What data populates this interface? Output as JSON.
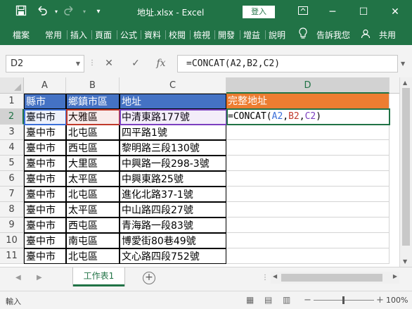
{
  "window": {
    "title": "地址.xlsx - Excel",
    "login_label": "登入",
    "minimize": "─",
    "restore": "☐",
    "close": "✕"
  },
  "quick_access": {
    "save_icon": "save-icon",
    "undo_icon": "undo-icon",
    "redo_icon": "redo-icon",
    "customize_icon": "customize-icon"
  },
  "ribbon": {
    "tabs": [
      "檔案",
      "常用",
      "插入",
      "頁面",
      "公式",
      "資料",
      "校閱",
      "檢視",
      "開發",
      "增益",
      "說明"
    ],
    "tell_me": "告訴我您",
    "share": "共用"
  },
  "formula_bar": {
    "name_box": "D2",
    "cancel": "✕",
    "enter": "✓",
    "fx": "fx",
    "formula": "=CONCAT(A2,B2,C2)"
  },
  "columns": [
    "A",
    "B",
    "C",
    "D"
  ],
  "rows": [
    "1",
    "2",
    "3",
    "4",
    "5",
    "6",
    "7",
    "8",
    "9",
    "10",
    "11"
  ],
  "headers": {
    "a": "縣市",
    "b": "鄉鎮市區",
    "c": "地址",
    "d": "完整地址"
  },
  "data": [
    {
      "a": "臺中市",
      "b": "大雅區",
      "c": "中清東路177號"
    },
    {
      "a": "臺中市",
      "b": "北屯區",
      "c": "四平路1號"
    },
    {
      "a": "臺中市",
      "b": "西屯區",
      "c": "黎明路三段130號"
    },
    {
      "a": "臺中市",
      "b": "大里區",
      "c": "中興路一段298-3號"
    },
    {
      "a": "臺中市",
      "b": "太平區",
      "c": "中興東路25號"
    },
    {
      "a": "臺中市",
      "b": "北屯區",
      "c": "進化北路37-1號"
    },
    {
      "a": "臺中市",
      "b": "太平區",
      "c": "中山路四段27號"
    },
    {
      "a": "臺中市",
      "b": "西屯區",
      "c": "青海路一段83號"
    },
    {
      "a": "臺中市",
      "b": "南屯區",
      "c": "博愛街80巷49號"
    },
    {
      "a": "臺中市",
      "b": "北屯區",
      "c": "文心路四段752號"
    }
  ],
  "d2_formula": {
    "prefix": "=CONCAT(",
    "ref_a": "A2",
    "comma1": ",",
    "ref_b": "B2",
    "comma2": ",",
    "ref_c": "C2",
    "suffix": ")"
  },
  "sheet": {
    "tab_label": "工作表1",
    "add": "+"
  },
  "status": {
    "mode": "輸入",
    "zoom": "100%"
  },
  "colors": {
    "accent": "#217346",
    "header_blue": "#4472c4",
    "header_orange": "#ed7d31"
  }
}
